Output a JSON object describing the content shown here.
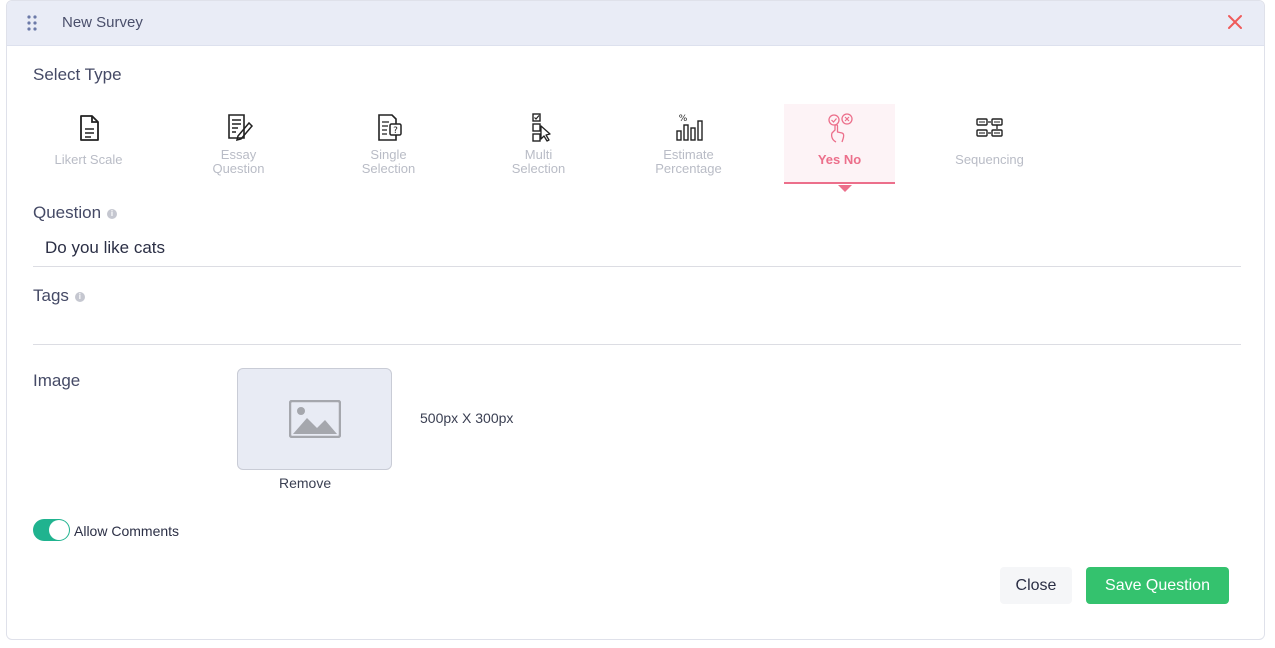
{
  "header": {
    "title": "New Survey"
  },
  "select_type": {
    "label": "Select Type",
    "types": [
      {
        "line1": "Likert Scale",
        "line2": "",
        "icon": "document-icon"
      },
      {
        "line1": "Essay",
        "line2": "Question",
        "icon": "essay-icon"
      },
      {
        "line1": "Single",
        "line2": "Selection",
        "icon": "single-selection-icon"
      },
      {
        "line1": "Multi",
        "line2": "Selection",
        "icon": "multi-selection-icon"
      },
      {
        "line1": "Estimate",
        "line2": "Percentage",
        "icon": "bar-chart-percent-icon"
      },
      {
        "line1": "Yes No",
        "line2": "",
        "icon": "yes-no-icon",
        "active": true
      },
      {
        "line1": "Sequencing",
        "line2": "",
        "icon": "sequencing-icon"
      }
    ]
  },
  "question": {
    "label": "Question",
    "value": "Do you like cats"
  },
  "tags": {
    "label": "Tags",
    "value": ""
  },
  "image": {
    "label": "Image",
    "remove_label": "Remove",
    "size_hint": "500px X 300px"
  },
  "allow_comments": {
    "label": "Allow Comments",
    "enabled": true
  },
  "footer": {
    "close_label": "Close",
    "save_label": "Save Question"
  },
  "colors": {
    "accent": "#ec6f8b",
    "save": "#34c26e",
    "toggle": "#20b38f",
    "close_icon": "#ef5a5a"
  }
}
